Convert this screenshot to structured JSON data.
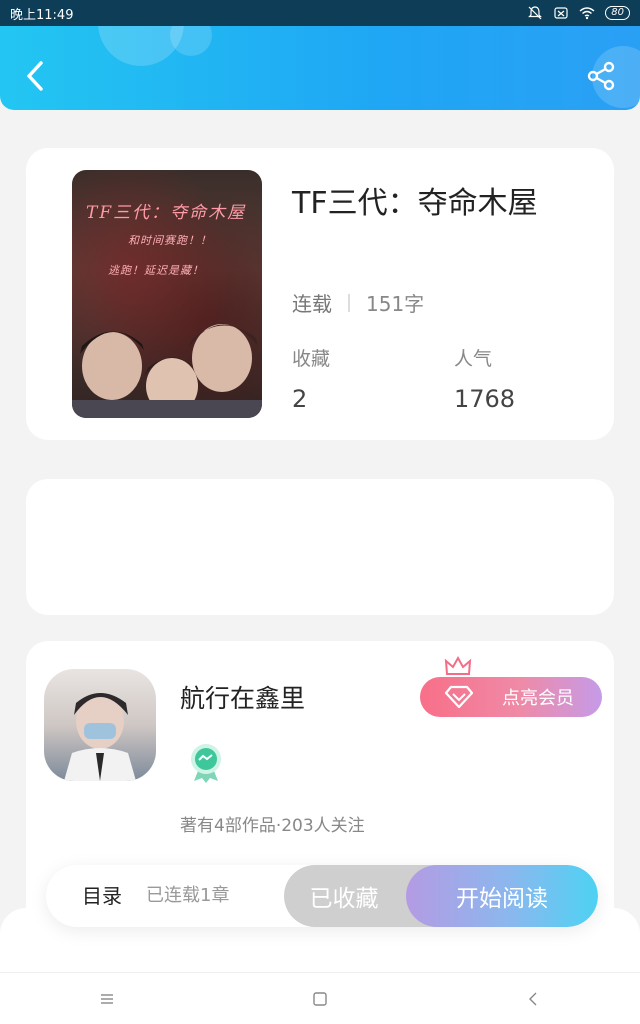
{
  "status_bar": {
    "time": "晚上11:49",
    "battery": "80"
  },
  "header": {
    "back_icon": "chevron-left-icon",
    "share_icon": "share-icon"
  },
  "book": {
    "cover_title": "TF三代：夺命木屋",
    "cover_line1": "和时间赛跑！！",
    "cover_line2": "逃跑！延迟是藏！",
    "title": "TF三代：夺命木屋",
    "status": "连载",
    "word_count": "151字",
    "favorites_label": "收藏",
    "favorites_value": "2",
    "popularity_label": "人气",
    "popularity_value": "1768"
  },
  "author": {
    "name": "航行在鑫里",
    "member_button": "点亮会员",
    "info": "著有4部作品·203人关注"
  },
  "action_bar": {
    "toc": "目录",
    "chapters": "已连载1章",
    "favorited": "已收藏",
    "start_reading": "开始阅读"
  },
  "colors": {
    "header_start": "#23c6f2",
    "header_end": "#2aa0f5",
    "member_start": "#f86f88",
    "member_end": "#c59be8",
    "read_start": "#b49be3",
    "read_end": "#4dd2f3"
  }
}
